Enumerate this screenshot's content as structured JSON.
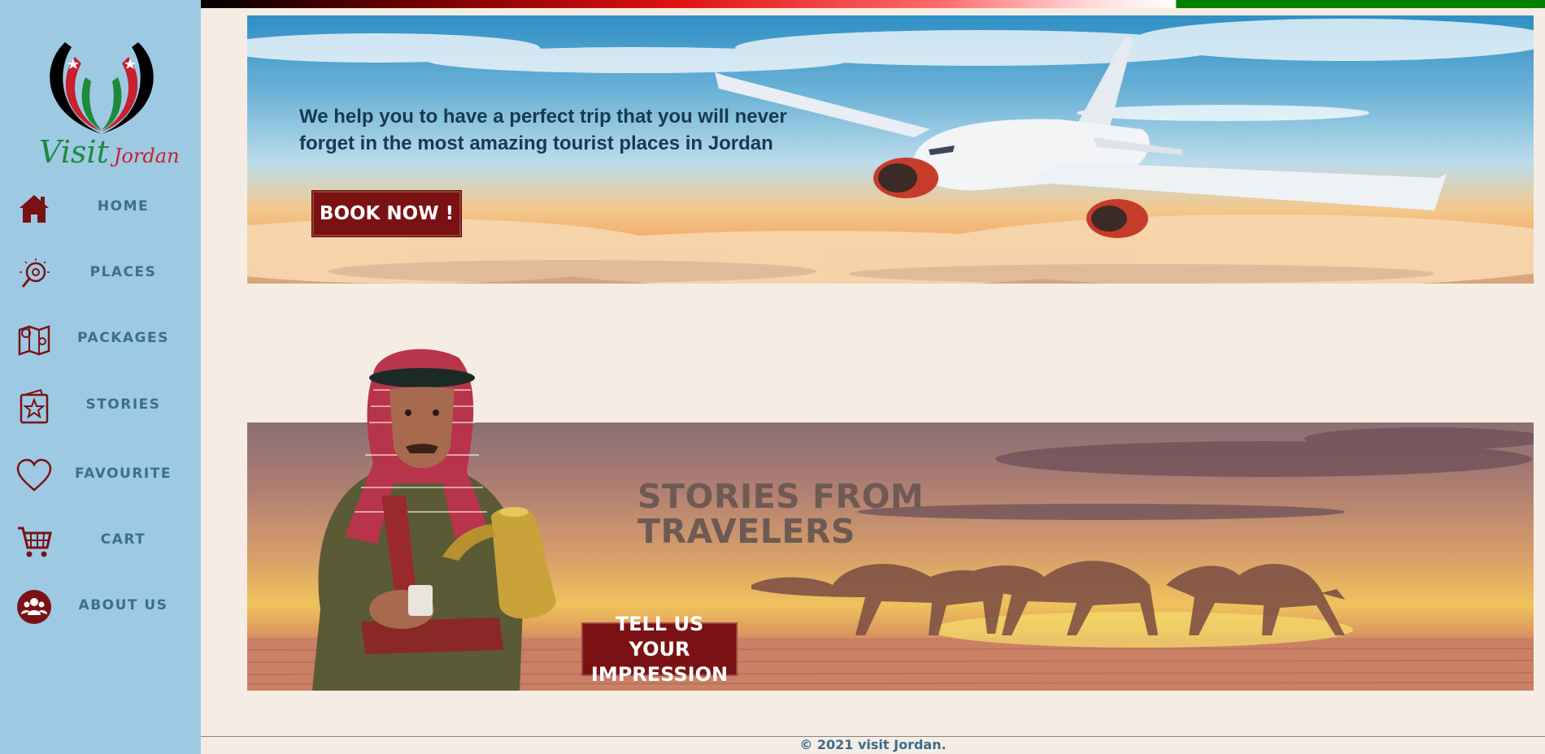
{
  "brand": {
    "logo_visit": "Visit",
    "logo_jordan": "Jordan",
    "colors": {
      "green": "#1e8a3c",
      "red": "#c8202e",
      "black": "#000000",
      "sidebar": "#9ec9e3",
      "button": "#7a1214"
    }
  },
  "sidebar": {
    "items": [
      {
        "label": "HOME",
        "icon": "home-icon"
      },
      {
        "label": "PLACES",
        "icon": "places-compass-icon"
      },
      {
        "label": "PACKAGES",
        "icon": "map-pin-icon"
      },
      {
        "label": "STORIES",
        "icon": "star-book-icon"
      },
      {
        "label": "FAVOURITE",
        "icon": "heart-icon"
      },
      {
        "label": "CART",
        "icon": "cart-icon"
      },
      {
        "label": "ABOUT US",
        "icon": "people-icon"
      }
    ]
  },
  "hero": {
    "text": "We help you to have a perfect trip that you will never forget in the most amazing tourist places in Jordan",
    "button_label": "BOOK NOW !"
  },
  "stories": {
    "title": "STORIES FROM TRAVELERS",
    "button_label": "TELL US YOUR IMPRESSION"
  },
  "footer": {
    "text": "© 2021 visit Jordan."
  }
}
